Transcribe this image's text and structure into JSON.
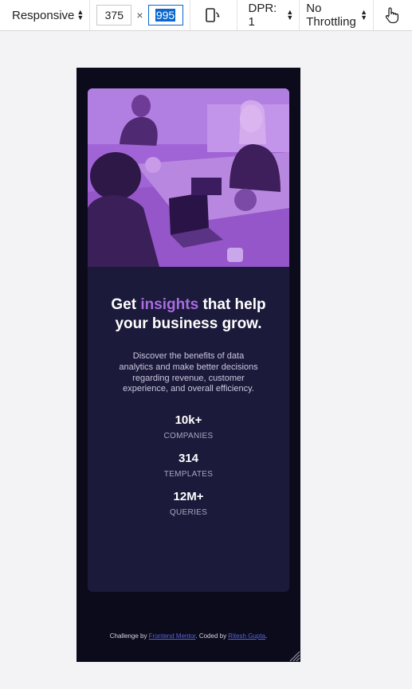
{
  "toolbar": {
    "device": "Responsive",
    "width": "375",
    "times": "×",
    "height": "995",
    "dpr": "DPR: 1",
    "throttling": "No Throttling"
  },
  "card": {
    "title_pre": "Get ",
    "title_accent": "insights",
    "title_post": " that help your business grow.",
    "description": "Discover the benefits of data analytics and make better decisions regarding revenue, customer experience, and overall efficiency.",
    "stats": [
      {
        "value": "10k+",
        "label": "COMPANIES"
      },
      {
        "value": "314",
        "label": "TEMPLATES"
      },
      {
        "value": "12M+",
        "label": "QUERIES"
      }
    ]
  },
  "footer": {
    "prefix": "Challenge by ",
    "link1": "Frontend Mentor",
    "middle": ". Coded by ",
    "link2": "Ritesh Gupta",
    "suffix": "."
  },
  "colors": {
    "accent": "#a76de0",
    "card_bg": "#1c1a3b",
    "page_bg": "#0b0b1c",
    "link": "#5a63d8"
  },
  "icons": [
    "sort-arrows-icon",
    "rotate-device-icon",
    "touch-icon",
    "image-office-photo",
    "resize-grip-icon"
  ]
}
